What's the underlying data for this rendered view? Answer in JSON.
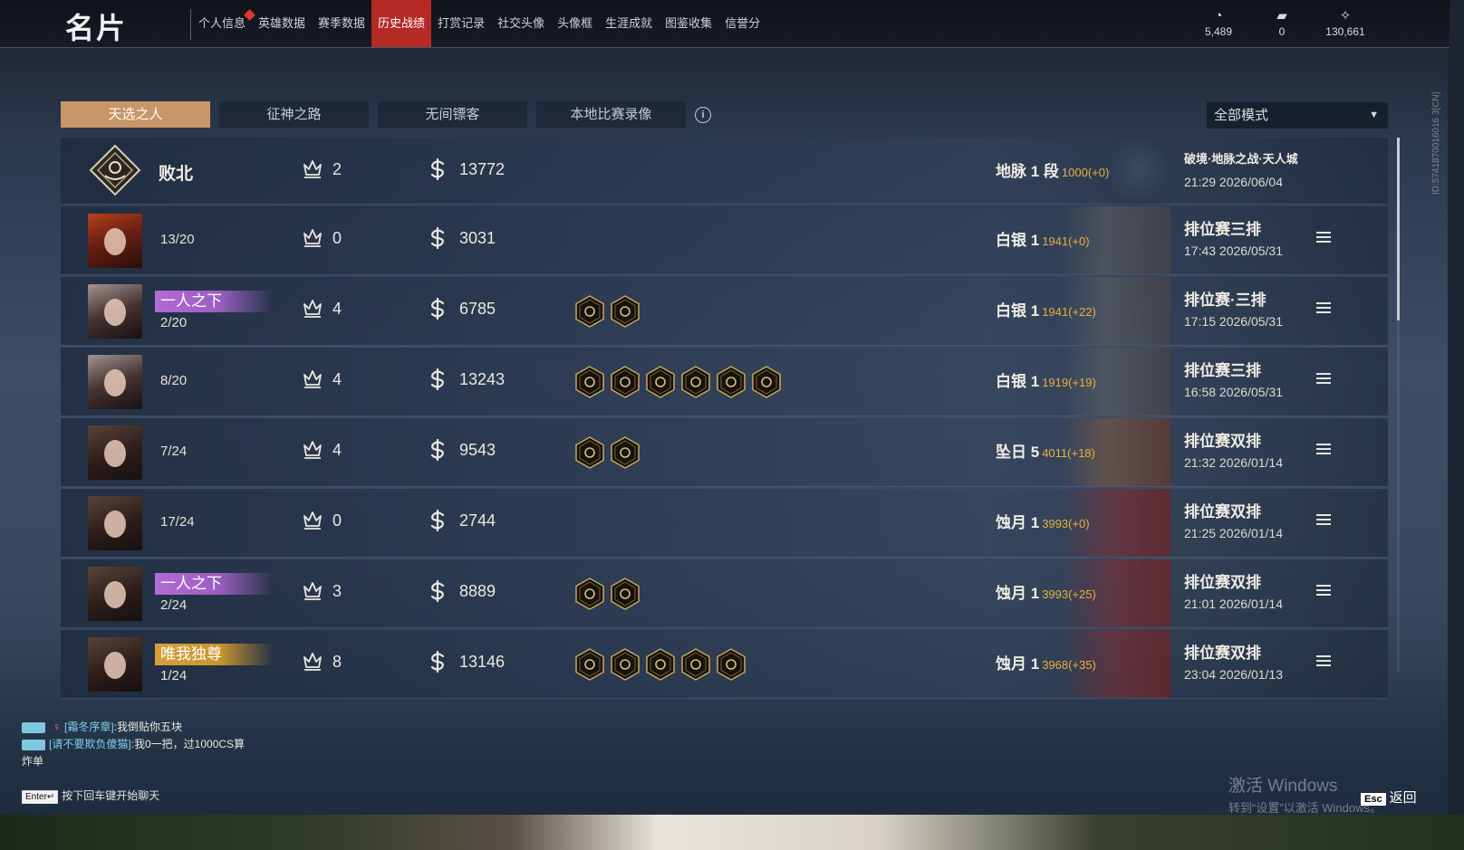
{
  "page_title": "名片",
  "nav": [
    {
      "label": "个人信息",
      "badge": true
    },
    {
      "label": "英雄数据"
    },
    {
      "label": "赛季数据"
    },
    {
      "label": "历史战绩",
      "active": true
    },
    {
      "label": "打赏记录"
    },
    {
      "label": "社交头像"
    },
    {
      "label": "头像框"
    },
    {
      "label": "生涯成就"
    },
    {
      "label": "图鉴收集"
    },
    {
      "label": "信誉分"
    }
  ],
  "currencies": [
    {
      "icon": "coin-stack-icon",
      "value": "5,489"
    },
    {
      "icon": "ticket-icon",
      "value": "0"
    },
    {
      "icon": "feather-gem-icon",
      "value": "130,661"
    }
  ],
  "side_id": "ID:5741870016016 3[CN]",
  "subtabs": [
    "天选之人",
    "征神之路",
    "无间镖客",
    "本地比赛录像"
  ],
  "info_icon": "i",
  "mode_filter": {
    "value": "全部模式",
    "arrow": "▼"
  },
  "matches": [
    {
      "type": "summary",
      "result": "败北",
      "kills": "2",
      "gold": "13772",
      "rank": "地脉 1 段",
      "pts": "1000(+0)",
      "mode": "破境·地脉之战·天人城",
      "mode_small": true,
      "time": "21:29 2026/06/04",
      "deco": "ring",
      "badges": 0
    },
    {
      "placement": "13/20",
      "kills": "0",
      "gold": "3031",
      "rank": "白银 1",
      "pts": "1941(+0)",
      "mode": "排位赛三排",
      "time": "17:43 2026/05/31",
      "avatar": "red",
      "deco": "silver",
      "badges": 0
    },
    {
      "tag": "一人之下",
      "tag_color": "purple",
      "placement": "2/20",
      "kills": "4",
      "gold": "6785",
      "rank": "白银 1",
      "pts": "1941(+22)",
      "mode": "排位赛·三排",
      "time": "17:15 2026/05/31",
      "avatar": "pale",
      "deco": "silver",
      "badges": 2
    },
    {
      "placement": "8/20",
      "kills": "4",
      "gold": "13243",
      "rank": "白银 1",
      "pts": "1919(+19)",
      "mode": "排位赛三排",
      "time": "16:58 2026/05/31",
      "avatar": "pale",
      "deco": "silver",
      "badges": 6
    },
    {
      "placement": "7/24",
      "kills": "4",
      "gold": "9543",
      "rank": "坠日 5",
      "pts": "4011(+18)",
      "mode": "排位赛双排",
      "time": "21:32 2026/01/14",
      "avatar": "dark",
      "deco": "gold",
      "badges": 2
    },
    {
      "placement": "17/24",
      "kills": "0",
      "gold": "2744",
      "rank": "蚀月 1",
      "pts": "3993(+0)",
      "mode": "排位赛双排",
      "time": "21:25 2026/01/14",
      "avatar": "dark",
      "deco": "red",
      "badges": 0
    },
    {
      "tag": "一人之下",
      "tag_color": "purple",
      "placement": "2/24",
      "kills": "3",
      "gold": "8889",
      "rank": "蚀月 1",
      "pts": "3993(+25)",
      "mode": "排位赛双排",
      "time": "21:01 2026/01/14",
      "avatar": "dark",
      "deco": "red",
      "badges": 2
    },
    {
      "tag": "唯我独尊",
      "tag_color": "gold",
      "placement": "1/24",
      "kills": "8",
      "gold": "13146",
      "rank": "蚀月 1",
      "pts": "3968(+35)",
      "mode": "排位赛双排",
      "time": "23:04 2026/01/13",
      "avatar": "dark",
      "deco": "red",
      "badges": 5
    }
  ],
  "chat": [
    {
      "name": "[霜冬序章]",
      "symbol": "♀",
      "text": ":我倒贴你五块"
    },
    {
      "name": "[请不要欺负傻猫]",
      "symbol": "",
      "text": ":我0一把，过1000CS算"
    },
    {
      "name": "",
      "symbol": "",
      "text": "炸单"
    }
  ],
  "chat_hint": {
    "key": "Enter↵",
    "text": "按下回车键开始聊天"
  },
  "watermark": {
    "line1": "激活 Windows",
    "line2": "转到“设置”以激活 Windows。"
  },
  "esc": {
    "key": "Esc",
    "label": "返回"
  },
  "colors": {
    "accent_red": "#b52a24",
    "tab_active": "#c89667",
    "points": "#e8b13a",
    "tag_purple": "#b26ad6",
    "tag_gold": "#d4a03a"
  }
}
